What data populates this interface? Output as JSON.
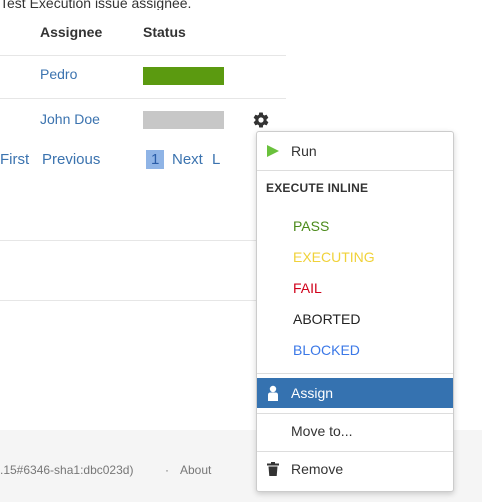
{
  "caption": "Test Execution issue assignee.",
  "table": {
    "headers": {
      "assignee": "Assignee",
      "status": "Status"
    },
    "rows": [
      {
        "assignee": "Pedro",
        "status_color": "#5b9a10"
      },
      {
        "assignee": "John Doe",
        "status_color": "#c7c7c7"
      }
    ]
  },
  "pager": {
    "first": "First",
    "previous": "Previous",
    "current": "1",
    "next": "Next",
    "last_partial": "L"
  },
  "menu": {
    "run": "Run",
    "execute_inline_header": "EXECUTE INLINE",
    "statuses": [
      {
        "label": "PASS",
        "color": "#4b8a1a"
      },
      {
        "label": "EXECUTING",
        "color": "#f0d23a"
      },
      {
        "label": "FAIL",
        "color": "#d0021b"
      },
      {
        "label": "ABORTED",
        "color": "#222222"
      },
      {
        "label": "BLOCKED",
        "color": "#3b78e7"
      }
    ],
    "assign": "Assign",
    "move_to": "Move to...",
    "remove": "Remove"
  },
  "footer": {
    "version": ".15#6346-sha1:dbc023d)",
    "dot": "·",
    "about": "About",
    "tail": "·"
  },
  "icons": {
    "gear": "gear-icon",
    "run": "play-icon",
    "assign": "user-icon",
    "remove": "trash-icon"
  }
}
